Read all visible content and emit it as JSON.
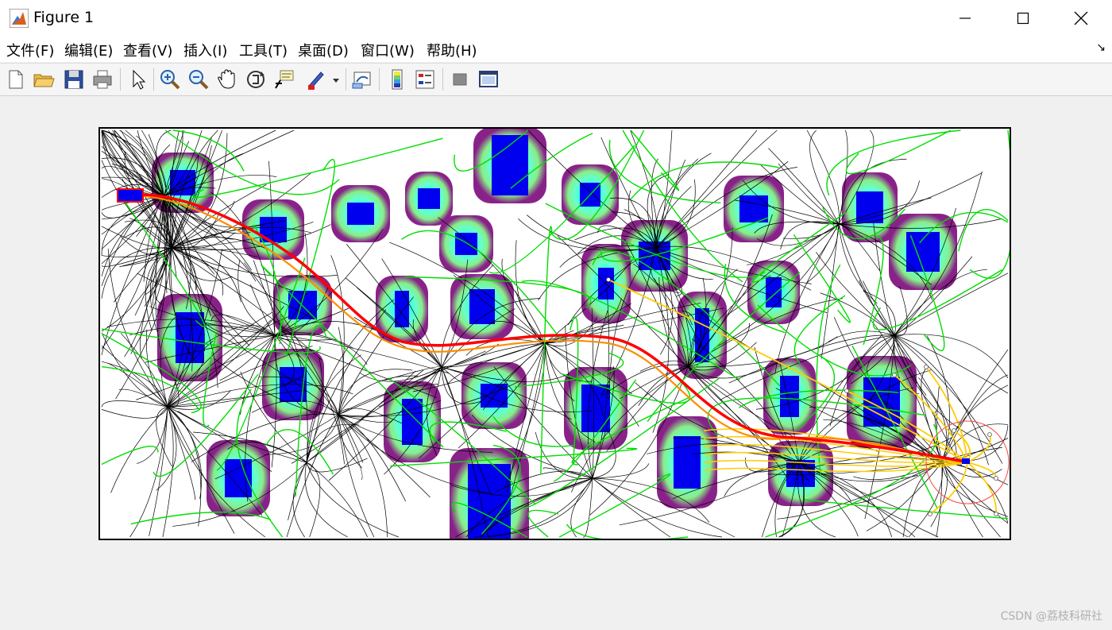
{
  "window": {
    "title": "Figure 1"
  },
  "menu": [
    "文件(F)",
    "编辑(E)",
    "查看(V)",
    "插入(I)",
    "工具(T)",
    "桌面(D)",
    "窗口(W)",
    "帮助(H)"
  ],
  "toolbar": {
    "buttons": [
      "new-figure",
      "open-file",
      "save-figure",
      "print-figure",
      "edit-plot-arrow",
      "zoom-in",
      "zoom-out",
      "pan-hand",
      "rotate-3d",
      "data-cursor",
      "brush",
      "link-plot",
      "colorbar",
      "legend",
      "hide-plot-tools",
      "show-plot-tools"
    ]
  },
  "colors": {
    "obstacle_core": "#0000ee",
    "inflation_inner": "#00ffff",
    "inflation_mid": "#88ee88",
    "inflation_outer": "#882288",
    "tree_branches": "#000000",
    "sampled_paths": "#00dd00",
    "candidate_paths": "#ffcc00",
    "final_path": "#ff0000",
    "goal_circle": "#ff4444"
  },
  "watermark": "CSDN @荔枝科研社"
}
